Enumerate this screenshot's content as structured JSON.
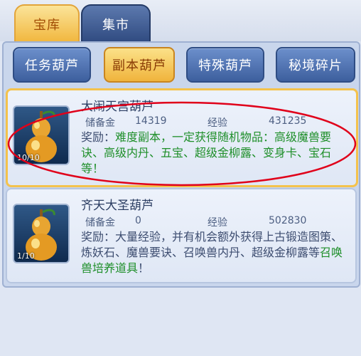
{
  "tabs": [
    {
      "label": "宝库",
      "active": false
    },
    {
      "label": "集市",
      "active": true
    }
  ],
  "categories": [
    {
      "label": "任务葫芦",
      "selected": false
    },
    {
      "label": "副本葫芦",
      "selected": true
    },
    {
      "label": "特殊葫芦",
      "selected": false
    },
    {
      "label": "秘境碎片",
      "selected": false
    }
  ],
  "items": [
    {
      "name": "大闹天宫葫芦",
      "reserve_label": "储备金",
      "reserve_value": "14319",
      "exp_label": "经验",
      "exp_value": "431235",
      "count": "10/10",
      "reward_label": "奖励：",
      "reward_plain": "",
      "reward_green": "难度副本，一定获得随机物品：高级魔兽要诀、高级内丹、五宝、超级金柳露、变身卡、宝石等！",
      "highlighted": true
    },
    {
      "name": "齐天大圣葫芦",
      "reserve_label": "储备金",
      "reserve_value": "0",
      "exp_label": "经验",
      "exp_value": "502830",
      "count": "1/10",
      "reward_label": "奖励：",
      "reward_plain": "大量经验，并有机会额外获得上古锻造图策、炼妖石、魔兽要诀、召唤兽内丹、超级金柳露等",
      "reward_green": "召唤兽培养道具",
      "reward_tail": "！",
      "highlighted": false
    }
  ],
  "colors": {
    "accent_gold": "#f1b63c",
    "tab_blue": "#2f4a80",
    "reward_green": "#1f8f2a",
    "annotation_red": "#e0001a"
  }
}
